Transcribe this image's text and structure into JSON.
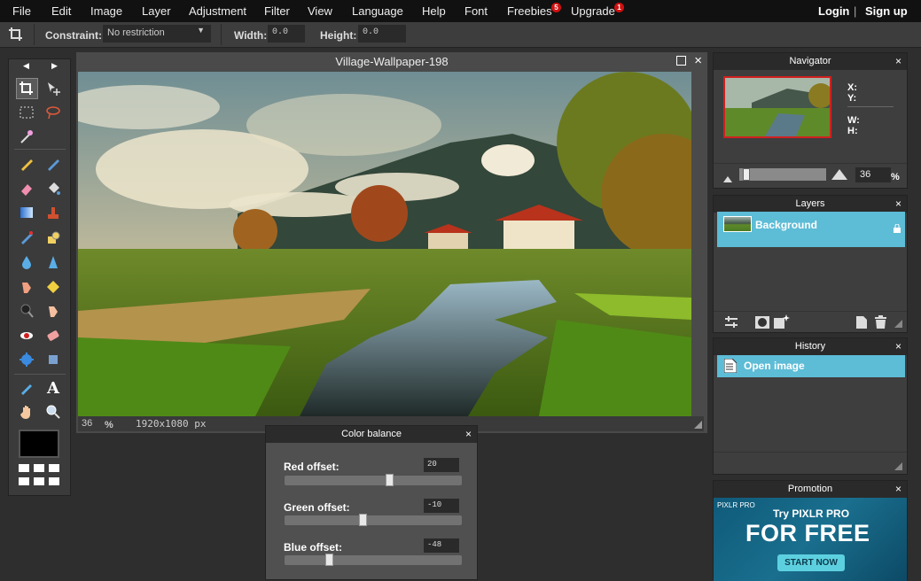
{
  "menu": {
    "items": [
      "File",
      "Edit",
      "Image",
      "Layer",
      "Adjustment",
      "Filter",
      "View",
      "Language",
      "Help",
      "Font",
      "Freebies",
      "Upgrade"
    ],
    "freebies_badge": "5",
    "upgrade_badge": "1",
    "login": "Login",
    "separator": "|",
    "signup": "Sign up"
  },
  "options": {
    "constraint_label": "Constraint:",
    "constraint_value": "No restriction",
    "width_label": "Width:",
    "width_value": "0.0",
    "height_label": "Height:",
    "height_value": "0.0"
  },
  "document": {
    "title": "Village-Wallpaper-198",
    "zoom": "36",
    "zoom_unit": "%",
    "dimensions": "1920x1080 px"
  },
  "navigator": {
    "title": "Navigator",
    "x_label": "X:",
    "y_label": "Y:",
    "w_label": "W:",
    "h_label": "H:",
    "zoom_value": "36",
    "zoom_unit": "%"
  },
  "layers": {
    "title": "Layers",
    "items": [
      {
        "name": "Background"
      }
    ]
  },
  "history": {
    "title": "History",
    "items": [
      {
        "name": "Open image"
      }
    ]
  },
  "promotion": {
    "title": "Promotion",
    "brand": "PIXLR PRO",
    "line1": "Try PIXLR PRO",
    "line2": "FOR FREE",
    "cta": "START NOW"
  },
  "color_balance": {
    "title": "Color balance",
    "red_label": "Red offset:",
    "red_value": "20",
    "green_label": "Green offset:",
    "green_value": "-10",
    "blue_label": "Blue offset:",
    "blue_value": "-48"
  },
  "colors": {
    "accent": "#5dbcd6",
    "badge": "#d01010",
    "menubar": "#111111",
    "panel": "#3e3e3e"
  }
}
